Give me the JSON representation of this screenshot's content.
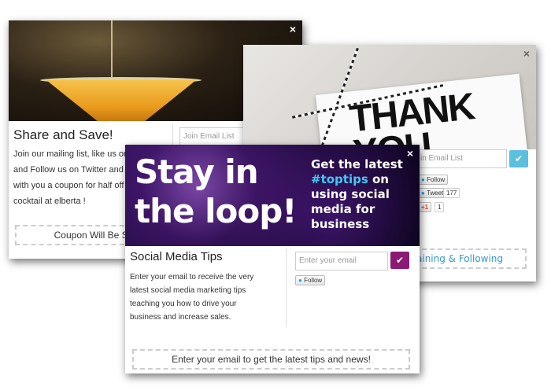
{
  "popup1": {
    "close_label": "×",
    "title": "Share and Save!",
    "body": "Join our mailing list, like us on Fa... and Follow us on Twitter and we... with you a coupon for half off yo... cocktail at elberta !",
    "body_lines": [
      "Join our mailing list, like us on Fa",
      "and Follow us on Twitter and we",
      "with you a coupon for half off yo",
      "cocktail at elberta !"
    ],
    "email_placeholder": "Join Email List",
    "coupon_label": "Coupon Will Be Sh"
  },
  "popup2": {
    "close_label": "×",
    "card_text": "THANK YOU",
    "card_line1": "THANK",
    "card_line2": "YOU",
    "email_placeholder": "in Email List",
    "submit_icon": "check-icon",
    "follow_label": "Follow",
    "tweet_label": "Tweet",
    "tweet_count": "177",
    "gplus_label": "+1",
    "gplus_count": "1",
    "bar_label": "aining & Following",
    "submit_color": "#5bc0de"
  },
  "popup3": {
    "close_label": "×",
    "hero_left_line1": "Stay in",
    "hero_left_line2": "the loop!",
    "hero_right_line1": "Get the latest",
    "hero_right_hashtag": "#toptips",
    "hero_right_line2_suffix": " on",
    "hero_right_line3": "using social",
    "hero_right_line4": "media for",
    "hero_right_line5": "business",
    "title": "Social Media Tips",
    "body_lines": [
      "Enter your email to receive the very",
      "latest social media marketing tips",
      "teaching you how to drive your",
      "business and increase sales."
    ],
    "email_placeholder": "Enter your email",
    "submit_icon": "check-icon",
    "follow_label": "Follow",
    "bar_label": "Enter your email to get the latest tips and news!",
    "submit_color": "#8a1a73",
    "hashtag_color": "#42c8f4"
  }
}
